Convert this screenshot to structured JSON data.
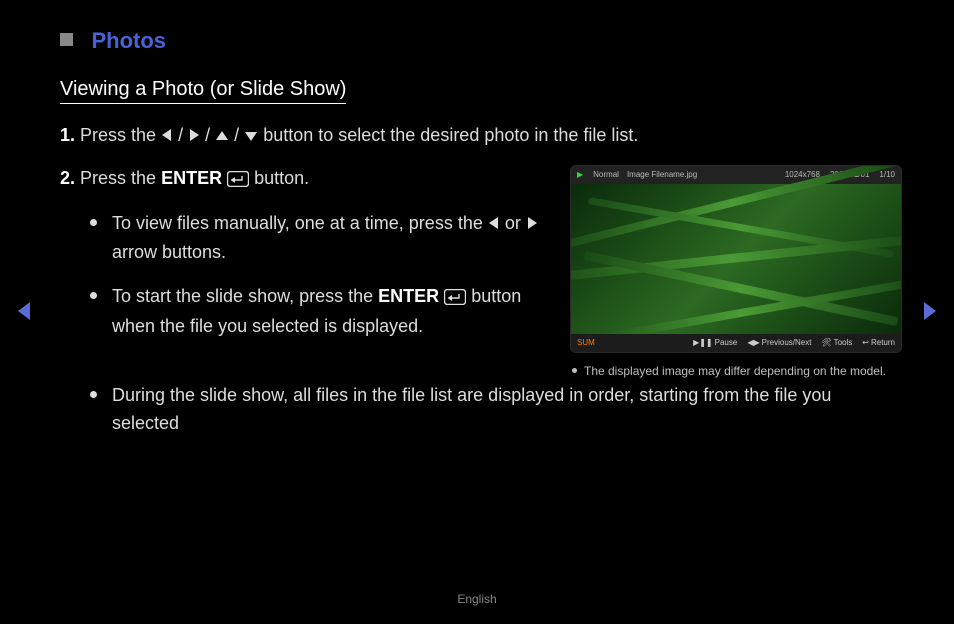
{
  "section": "Photos",
  "heading": "Viewing a Photo (or Slide Show)",
  "step1_a": "Press the ",
  "step1_b": " button to select the desired photo in the file list.",
  "step2_a": "Press the ",
  "step2_enter": "ENTER",
  "step2_b": " button.",
  "bullet1_a": "To view files manually, one at a time, press the ",
  "bullet1_or": " or ",
  "bullet1_b": " arrow buttons.",
  "bullet2_a": "To start the slide show, press the ",
  "bullet2_enter": "ENTER",
  "bullet2_b": " button when the file you selected is displayed.",
  "bullet3": "During the slide show, all files in the file list are displayed in order, starting from the file you selected",
  "caption": "The displayed image may differ depending on the model.",
  "footer": "English",
  "preview": {
    "mode": "Normal",
    "filename": "Image Filename.jpg",
    "res": "1024x768",
    "date": "2011/01/01",
    "count": "1/10",
    "sum": "SUM",
    "pause": "Pause",
    "prevnext": "Previous/Next",
    "tools": "Tools",
    "return": "Return"
  }
}
